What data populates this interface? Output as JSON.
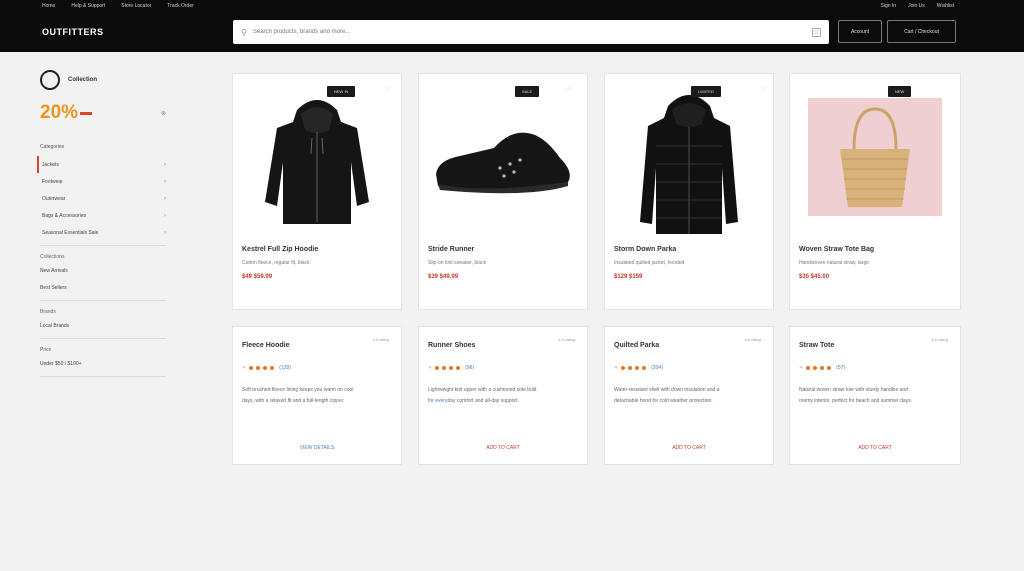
{
  "header": {
    "utility_links": [
      "Home",
      "Help & Support",
      "Store Locator",
      "Track Order"
    ],
    "utility_right": [
      "Sign In",
      "Join Us",
      "Wishlist"
    ],
    "logo": "OUTFITTERS",
    "search_placeholder": "Search products, brands and more...",
    "account_label": "Account",
    "cart_label": "Cart / Checkout"
  },
  "sidebar": {
    "brand": "Collection",
    "promo": "20%",
    "categories_title": "Categories",
    "categories": [
      "Jackets",
      "Footwear",
      "Outerwear",
      "Bags & Accessories",
      "Seasonal Essentials Sale"
    ],
    "section1_title": "Collections",
    "section1_items": [
      "New Arrivals",
      "Best Sellers"
    ],
    "section2_title": "Brands",
    "section2_items": [
      "Local Brands"
    ],
    "section3_title": "Price",
    "section3_items": [
      "Under $50 / $100+"
    ]
  },
  "products": [
    {
      "title": "Kestrel Full Zip Hoodie",
      "subtitle": "Cotton fleece, regular fit, black",
      "price": "$49 $59.99",
      "badge": "NEW IN",
      "badge_x": "♡"
    },
    {
      "title": "Stride Runner",
      "subtitle": "Slip-on knit sneaker, black",
      "price": "$39 $49.99",
      "badge": "SALE",
      "badge_x": "♡"
    },
    {
      "title": "Storm Down Parka",
      "subtitle": "Insulated quilted jacket, hooded",
      "price": "$129 $159",
      "badge": "LIMITED",
      "badge_x": "♡"
    },
    {
      "title": "Woven Straw Tote Bag",
      "subtitle": "Handwoven natural straw, large",
      "price": "$35 $45.00",
      "badge": "NEW",
      "badge_x": ""
    }
  ],
  "info_cards": [
    {
      "title": "Fleece Hoodie",
      "meta": "4.6 rating",
      "reviews": "(128)",
      "desc1": "Soft brushed fleece lining keeps you warm on cool",
      "desc2": "days, with a relaxed fit and a full-length ",
      "desc_hl": "zipper",
      "desc3": ".",
      "link": "VIEW DETAILS",
      "link_color": "#4a7ab7"
    },
    {
      "title": "Runner Shoes",
      "meta": "4.3 rating",
      "reviews": "(96)",
      "desc1": "Lightweight knit upper with a cushioned sole built",
      "desc2": "",
      "desc_hl": "for everyday",
      "desc3": " comfort and all-day support.",
      "link": "ADD TO CART",
      "link_color": "#c23a2a"
    },
    {
      "title": "Quilted Parka",
      "meta": "4.8 rating",
      "reviews": "(204)",
      "desc1": "Water-resistant shell with down insulation and a",
      "desc2": "detachable hood for cold weather protection.",
      "desc_hl": "",
      "desc3": "",
      "link": "ADD TO CART",
      "link_color": "#c23a2a"
    },
    {
      "title": "Straw Tote",
      "meta": "4.5 rating",
      "reviews": "(57)",
      "desc1": "Natural woven straw tote with sturdy handles and",
      "desc2": "roomy interior, perfect for beach and summer days.",
      "desc_hl": "",
      "desc3": "",
      "link": "ADD TO CART",
      "link_color": "#c23a2a"
    }
  ]
}
